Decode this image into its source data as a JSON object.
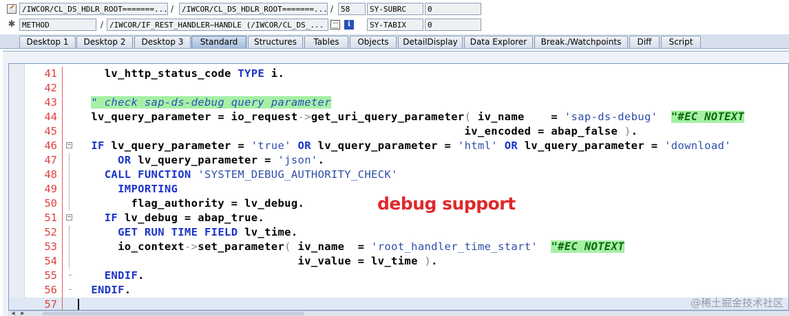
{
  "row1": {
    "field1": "/IWCOR/CL_DS_HDLR_ROOT=======...",
    "slash1": "/",
    "field2": "/IWCOR/CL_DS_HDLR_ROOT=======...",
    "slash2": "/",
    "line": "58",
    "sysvar": "SY-SUBRC",
    "sysval": "0"
  },
  "row2": {
    "field1": "METHOD",
    "slash1": "/",
    "field2": "/IWCOR/IF_REST_HANDLER~HANDLE (/IWCOR/CL_DS_...",
    "sysvar": "SY-TABIX",
    "sysval": "0",
    "info_glyph": "i"
  },
  "tabs": [
    {
      "label": "Desktop 1"
    },
    {
      "label": "Desktop 2"
    },
    {
      "label": "Desktop 3"
    },
    {
      "label": "Standard"
    },
    {
      "label": "Structures"
    },
    {
      "label": "Tables"
    },
    {
      "label": "Objects"
    },
    {
      "label": "DetailDisplay"
    },
    {
      "label": "Data Explorer"
    },
    {
      "label": "Break./Watchpoints"
    },
    {
      "label": "Diff"
    },
    {
      "label": "Script"
    }
  ],
  "active_tab": "Standard",
  "code": [
    {
      "n": "41",
      "text": "    lv_http_status_code TYPE i."
    },
    {
      "n": "42",
      "text": ""
    },
    {
      "n": "43",
      "text": "  \" check sap-ds-debug query parameter"
    },
    {
      "n": "44",
      "text": "  lv_query_parameter = io_request->get_uri_query_parameter( iv_name    = 'sap-ds-debug'  \"#EC NOTEXT"
    },
    {
      "n": "45",
      "text": "                                                          iv_encoded = abap_false )."
    },
    {
      "n": "46",
      "text": "  IF lv_query_parameter = 'true' OR lv_query_parameter = 'html' OR lv_query_parameter = 'download'"
    },
    {
      "n": "47",
      "text": "      OR lv_query_parameter = 'json'."
    },
    {
      "n": "48",
      "text": "    CALL FUNCTION 'SYSTEM_DEBUG_AUTHORITY_CHECK'"
    },
    {
      "n": "49",
      "text": "      IMPORTING"
    },
    {
      "n": "50",
      "text": "        flag_authority = lv_debug."
    },
    {
      "n": "51",
      "text": "    IF lv_debug = abap_true."
    },
    {
      "n": "52",
      "text": "      GET RUN TIME FIELD lv_time."
    },
    {
      "n": "53",
      "text": "      io_context->set_parameter( iv_name  = 'root_handler_time_start'  \"#EC NOTEXT"
    },
    {
      "n": "54",
      "text": "                                 iv_value = lv_time )."
    },
    {
      "n": "55",
      "text": "    ENDIF."
    },
    {
      "n": "56",
      "text": "  ENDIF."
    },
    {
      "n": "57",
      "text": ""
    }
  ],
  "current_line": "57",
  "annotation": "debug support",
  "watermark": "@稀土掘金技术社区",
  "colors": {
    "line_number": "#e04040",
    "keyword": "#1c34c8",
    "comment_bg": "#a6f0a6",
    "annotation": "#e0282a"
  }
}
